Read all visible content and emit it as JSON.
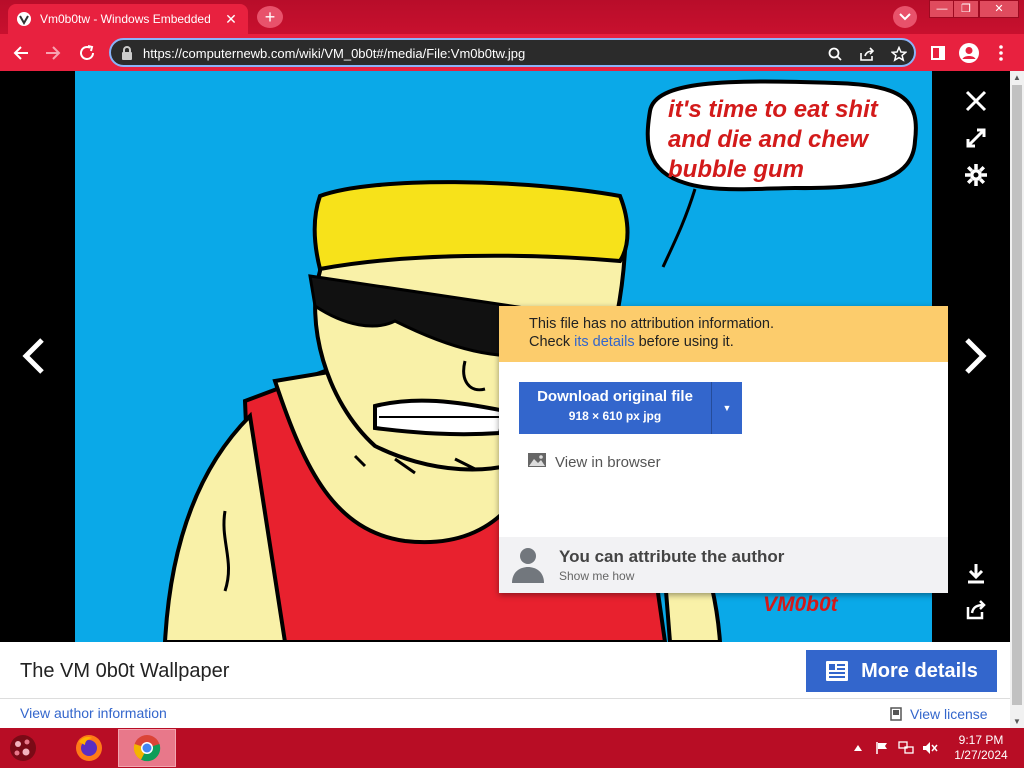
{
  "browser": {
    "tab_title": "Vm0b0tw - Windows Embedded",
    "url": "https://computernewb.com/wiki/VM_0b0t#/media/File:Vm0b0tw.jpg",
    "accent": "#e8213f"
  },
  "image": {
    "speech_text": "it's time to eat shit and die and chew bubble gum",
    "signature": "VM0b0t"
  },
  "popup": {
    "warning_line1": "This file has no attribution information.",
    "warning_check": "Check ",
    "warning_link": "its details",
    "warning_after": " before using it.",
    "download_label": "Download original file",
    "download_meta": "918 × 610 px jpg",
    "view_in_browser": "View in browser",
    "attribute_title": "You can attribute the author",
    "attribute_sub": "Show me how"
  },
  "info": {
    "file_title": "The VM 0b0t Wallpaper",
    "more_details": "More details",
    "view_author": "View author information",
    "view_license": "View license"
  },
  "taskbar": {
    "time": "9:17 PM",
    "date": "1/27/2024"
  }
}
